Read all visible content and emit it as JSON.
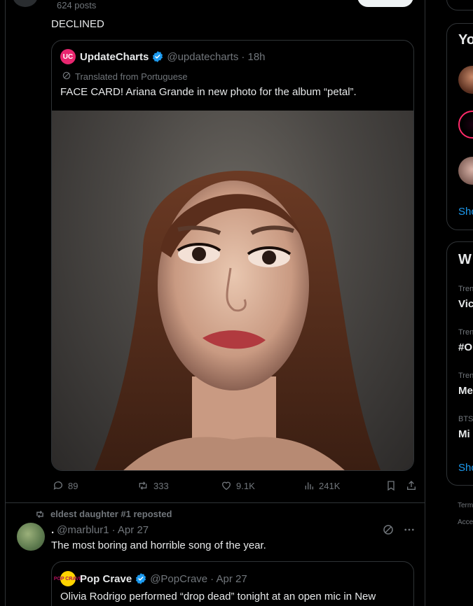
{
  "profile_header": {
    "posts_count": "624 posts"
  },
  "post1": {
    "text": "DECLINED",
    "quote": {
      "logo": "UC",
      "name": "UpdateCharts",
      "handle": "@updatecharts",
      "time": "· 18h",
      "translated": "Translated from Portuguese",
      "text": "FACE CARD! Ariana Grande in new photo for the album “petal”."
    },
    "actions": {
      "replies": "89",
      "reposts": "333",
      "likes": "9.1K",
      "views": "241K"
    }
  },
  "post2": {
    "repost_by": "eldest daughter #1 reposted",
    "name": ".",
    "handle": "@marblur1",
    "time": "· Apr 27",
    "text": "The most boring and horrible song of the year.",
    "quote": {
      "logo": "POP CRAVE",
      "name": "Pop Crave",
      "handle": "@PopCrave",
      "time": "· Apr 27",
      "text": "Olivia Rodrigo performed “drop dead” tonight at an open mic in New"
    }
  },
  "sidebar": {
    "who_to_follow_title": "Yo",
    "who_to_follow_show": "Sho",
    "trends_title": "W",
    "trends": [
      {
        "category": "Tren",
        "name": "Vic"
      },
      {
        "category": "Tren",
        "name": "#O"
      },
      {
        "category": "Tren",
        "name": "Me"
      },
      {
        "category": "BTS",
        "name": "Mi"
      }
    ],
    "trends_show": "Sho",
    "footer": [
      "Term",
      "Acce"
    ]
  },
  "colors": {
    "accent": "#1d9bf0",
    "verified": "#1d9bf0",
    "updatecharts_brand": "#e8266f",
    "popcrave_brand": "#ffd400"
  }
}
